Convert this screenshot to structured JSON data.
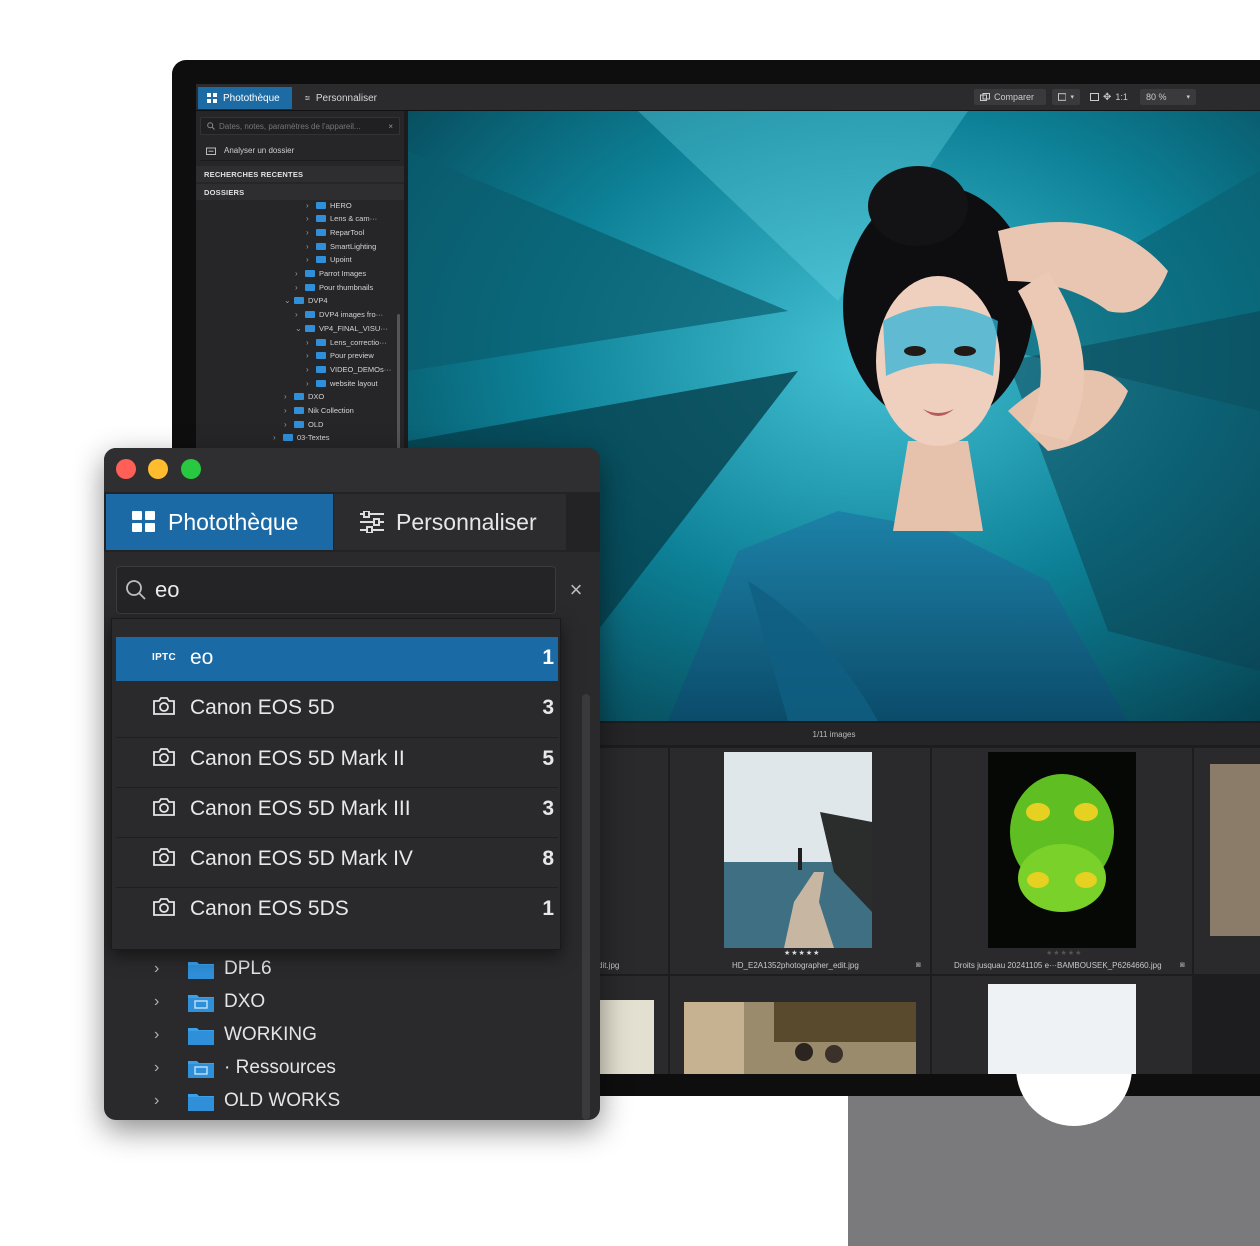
{
  "main_window": {
    "tabs": [
      "Photothèque",
      "Personnaliser"
    ],
    "toolbar": {
      "compare": "Comparer",
      "zoom_one": "1:1",
      "zoom_level": "80 %"
    },
    "search_placeholder": "Dates, notes, paramètres de l'appareil...",
    "analyze_folder": "Analyser un dossier",
    "sections": {
      "recent": "RECHERCHES RECENTES",
      "folders": "DOSSIERS"
    },
    "folder_tree": [
      {
        "label": "HERO",
        "depth": 3
      },
      {
        "label": "Lens & cam···",
        "depth": 3
      },
      {
        "label": "ReparTool",
        "depth": 3
      },
      {
        "label": "SmartLighting",
        "depth": 3
      },
      {
        "label": "Upoint",
        "depth": 3
      },
      {
        "label": "Parrot Images",
        "depth": 2
      },
      {
        "label": "Pour thumbnails",
        "depth": 2
      },
      {
        "label": "DVP4",
        "depth": 1,
        "open": true
      },
      {
        "label": "DVP4 images fro···",
        "depth": 2
      },
      {
        "label": "VP4_FINAL_VISU···",
        "depth": 2,
        "open": true
      },
      {
        "label": "Lens_correctio···",
        "depth": 3
      },
      {
        "label": "Pour preview",
        "depth": 3
      },
      {
        "label": "VIDEO_DEMOs···",
        "depth": 3
      },
      {
        "label": "website layout",
        "depth": 3
      },
      {
        "label": "DXO",
        "depth": 1
      },
      {
        "label": "Nik Collection",
        "depth": 1
      },
      {
        "label": "OLD",
        "depth": 1
      },
      {
        "label": "03-Textes",
        "depth": 0
      }
    ],
    "image_count": "1/11 images",
    "thumbnails": [
      {
        "caption": "HD_E2A1352photographer_edit.jpg",
        "stars": "★★★★★"
      },
      {
        "caption": "Droits jusquau 20241105 e···BAMBOUSEK_P6264660.jpg",
        "stars": "★★★★★"
      }
    ],
    "partial_caption": "dit.jpg"
  },
  "popup_window": {
    "tabs": {
      "library": "Photothèque",
      "customize": "Personnaliser"
    },
    "search": {
      "value": "eo",
      "clear": "×"
    },
    "suggestions": [
      {
        "type": "IPTC",
        "label": "eo",
        "count": "1"
      },
      {
        "type": "camera",
        "label": "Canon EOS 5D",
        "count": "3"
      },
      {
        "type": "camera",
        "label": "Canon EOS 5D Mark II",
        "count": "5"
      },
      {
        "type": "camera",
        "label": "Canon EOS 5D Mark III",
        "count": "3"
      },
      {
        "type": "camera",
        "label": "Canon EOS 5D Mark IV",
        "count": "8"
      },
      {
        "type": "camera",
        "label": "Canon EOS 5DS",
        "count": "1"
      }
    ],
    "folders": [
      {
        "label": "DPL6",
        "kind": "plain"
      },
      {
        "label": "DXO",
        "kind": "network"
      },
      {
        "label": "WORKING",
        "kind": "plain"
      },
      {
        "label": "· Ressources",
        "kind": "network"
      },
      {
        "label": "OLD WORKS",
        "kind": "plain"
      }
    ]
  },
  "colors": {
    "accent": "#1b6aa6",
    "folder": "#2f8fd8",
    "close": "#ff5f57",
    "minimize": "#febc2e",
    "zoom": "#28c840"
  }
}
